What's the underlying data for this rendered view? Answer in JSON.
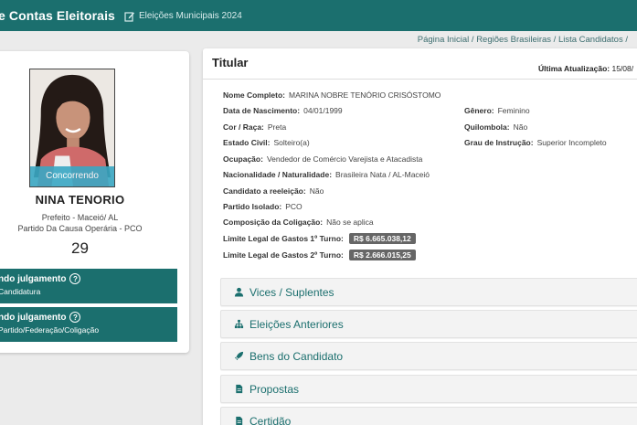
{
  "header": {
    "title": "e Contas Eleitorais",
    "election": "Eleições Municipais 2024"
  },
  "breadcrumb": "Página Inicial / Regiões Brasileiras / Lista Candidatos /",
  "candidate": {
    "status": "Concorrendo",
    "name": "NINA TENORIO",
    "office": "Prefeito - Maceió/ AL",
    "party": "Partido Da Causa Operária - PCO",
    "number": "29"
  },
  "judgments": [
    {
      "title": "ndo julgamento",
      "subtitle": "Candidatura"
    },
    {
      "title": "ndo julgamento",
      "subtitle": "Partido/Federação/Coligação"
    }
  ],
  "titular": {
    "title": "Titular",
    "update_label": "Última Atualização:",
    "update_value": "15/08/",
    "fields": {
      "nome": {
        "label": "Nome Completo:",
        "value": "MARINA NOBRE TENÓRIO CRISÓSTOMO"
      },
      "nascimento": {
        "label": "Data de Nascimento:",
        "value": "04/01/1999"
      },
      "genero": {
        "label": "Gênero:",
        "value": "Feminino"
      },
      "cor": {
        "label": "Cor / Raça:",
        "value": "Preta"
      },
      "quilombola": {
        "label": "Quilombola:",
        "value": "Não"
      },
      "civil": {
        "label": "Estado Civil:",
        "value": "Solteiro(a)"
      },
      "instrucao": {
        "label": "Grau de Instrução:",
        "value": "Superior Incompleto"
      },
      "ocupacao": {
        "label": "Ocupação:",
        "value": "Vendedor de Comércio Varejista e Atacadista"
      },
      "nacionalidade": {
        "label": "Nacionalidade / Naturalidade:",
        "value": "Brasileira Nata / AL-Maceió"
      },
      "reeleicao": {
        "label": "Candidato a reeleição:",
        "value": "Não"
      },
      "isolado": {
        "label": "Partido Isolado:",
        "value": "PCO"
      },
      "coligacao": {
        "label": "Composição da Coligação:",
        "value": "Não se aplica"
      },
      "limite1": {
        "label": "Limite Legal de Gastos 1º Turno:",
        "value": "R$ 6.665.038,12"
      },
      "limite2": {
        "label": "Limite Legal de Gastos 2º Turno:",
        "value": "R$ 2.666.015,25"
      }
    }
  },
  "sections": [
    {
      "label": "Vices / Suplentes",
      "icon": "user-icon"
    },
    {
      "label": "Eleições Anteriores",
      "icon": "hierarchy-icon"
    },
    {
      "label": "Bens do Candidato",
      "icon": "rocket-icon"
    },
    {
      "label": "Propostas",
      "icon": "document-icon"
    },
    {
      "label": "Certidão",
      "icon": "document-icon"
    }
  ],
  "colors": {
    "brand": "#1b6f6e",
    "status_band": "#3aa8c4",
    "money_badge": "#666666"
  }
}
